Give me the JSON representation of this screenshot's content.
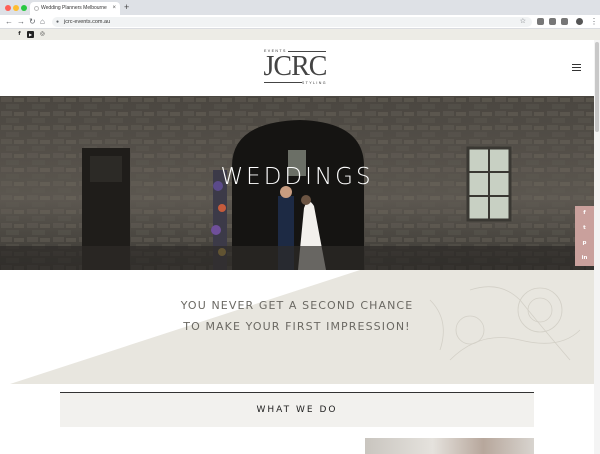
{
  "browser": {
    "tab_title": "Wedding Planners Melbourne",
    "tab_close": "×",
    "new_tab": "+",
    "url": "jcrc-events.com.au",
    "icons": [
      "back-icon",
      "forward-icon",
      "reload-icon",
      "home-icon",
      "lock-icon",
      "star-icon",
      "account-icon",
      "menu-icon"
    ]
  },
  "social": {
    "facebook": "f",
    "youtube": "▶",
    "instagram": "◎"
  },
  "logo": {
    "top_tag": "EVENTS",
    "brand": "JCRC",
    "bottom_tag": "STYLING"
  },
  "hero": {
    "title": "WEDDINGS"
  },
  "share": {
    "facebook": "f",
    "twitter": "t",
    "pinterest": "p",
    "linkedin": "in"
  },
  "intro": {
    "line1": "YOU NEVER GET A SECOND CHANCE",
    "line2": "TO MAKE YOUR FIRST IMPRESSION!"
  },
  "section": {
    "heading": "WHAT WE DO"
  },
  "colors": {
    "accent_share": "#c9a09c",
    "intro_text": "#6b6963",
    "light_band": "#edece6"
  }
}
